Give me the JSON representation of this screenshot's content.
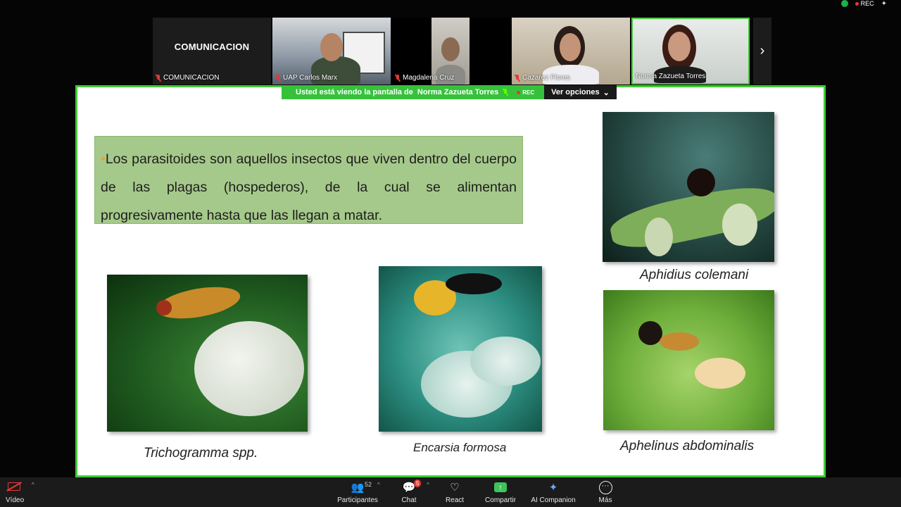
{
  "top_status": {
    "rec_label": "REC"
  },
  "participants": [
    {
      "title": "COMUNICACION",
      "name": "COMUNICACION",
      "muted": true
    },
    {
      "name": "UAP Carlos Marx",
      "muted": true
    },
    {
      "name": "Magdalena Cruz",
      "muted": true
    },
    {
      "name": "Cazarez Flores",
      "muted": true
    },
    {
      "name": "Norma Zazueta Torres",
      "muted": false,
      "active_speaker": true
    }
  ],
  "share_banner": {
    "viewing_text": "Usted está viendo la pantalla de",
    "presenter": "Norma Zazueta Torres",
    "rec_label": "REC",
    "options_label": "Ver opciones"
  },
  "slide": {
    "paragraph": "Los parasitoides son aquellos insectos que viven dentro del cuerpo de las plagas (hospederos), de la cual se alimentan progresivamente hasta que las llegan a matar.",
    "captions": {
      "trichogramma": "Trichogramma spp.",
      "encarsia": "Encarsia formosa",
      "aphidius": "Aphidius colemani",
      "aphelinus": "Aphelinus abdominalis"
    }
  },
  "toolbar": {
    "video_label": "Vídeo",
    "participants_label": "Participantes",
    "participants_count": "52",
    "chat_label": "Chat",
    "chat_badge": "5",
    "react_label": "React",
    "share_label": "Compartir",
    "ai_label": "AI Companion",
    "more_label": "Más"
  },
  "colors": {
    "speaker_border": "#3fcc37",
    "share_button": "#3dc45a",
    "slide_box": "#a5c98a",
    "muted_red": "#e53935"
  }
}
